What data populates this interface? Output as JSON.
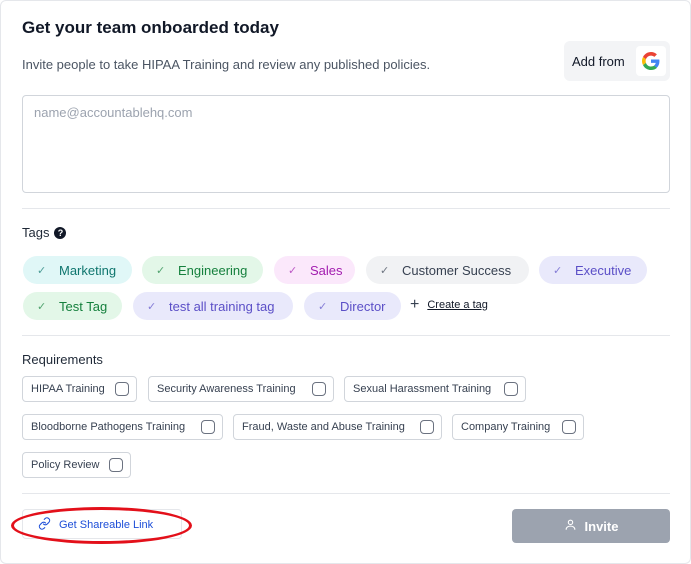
{
  "header": {
    "title": "Get your team onboarded today",
    "subtitle": "Invite people to take HIPAA Training and review any published policies.",
    "add_from_label": "Add from",
    "add_from_icon": "google-icon"
  },
  "email_input": {
    "placeholder": "name@accountablehq.com",
    "value": ""
  },
  "tags_section": {
    "label": "Tags",
    "help_icon": "question-circle-icon",
    "tags": [
      {
        "label": "Marketing",
        "color": "#0f766e",
        "background": "#e0f7f7"
      },
      {
        "label": "Engineering",
        "color": "#15803d",
        "background": "#e3f7e8"
      },
      {
        "label": "Sales",
        "color": "#a21caf",
        "background": "#fbe8fb"
      },
      {
        "label": "Customer Success",
        "color": "#374151",
        "background": "#f1f2f4"
      },
      {
        "label": "Executive",
        "color": "#5b4fc7",
        "background": "#e9e9fb"
      },
      {
        "label": "Test Tag",
        "color": "#15803d",
        "background": "#e3f7e8"
      },
      {
        "label": "test all training tag",
        "color": "#5b4fc7",
        "background": "#e9e9fb"
      },
      {
        "label": "Director",
        "color": "#5b4fc7",
        "background": "#e9e9fb"
      }
    ],
    "create_label": "Create a tag"
  },
  "requirements_section": {
    "label": "Requirements",
    "items": [
      {
        "label": "HIPAA Training",
        "checked": false
      },
      {
        "label": "Security Awareness Training",
        "checked": false
      },
      {
        "label": "Sexual Harassment Training",
        "checked": false
      },
      {
        "label": "Bloodborne Pathogens Training",
        "checked": false
      },
      {
        "label": "Fraud, Waste and Abuse Training",
        "checked": false
      },
      {
        "label": "Company Training",
        "checked": false
      },
      {
        "label": "Policy Review",
        "checked": false
      }
    ]
  },
  "footer": {
    "share_link_label": "Get Shareable Link",
    "invite_label": "Invite"
  },
  "colors": {
    "annotation_red": "#e3101a",
    "link_blue": "#1d4ed8",
    "invite_disabled": "#9ca3af"
  }
}
